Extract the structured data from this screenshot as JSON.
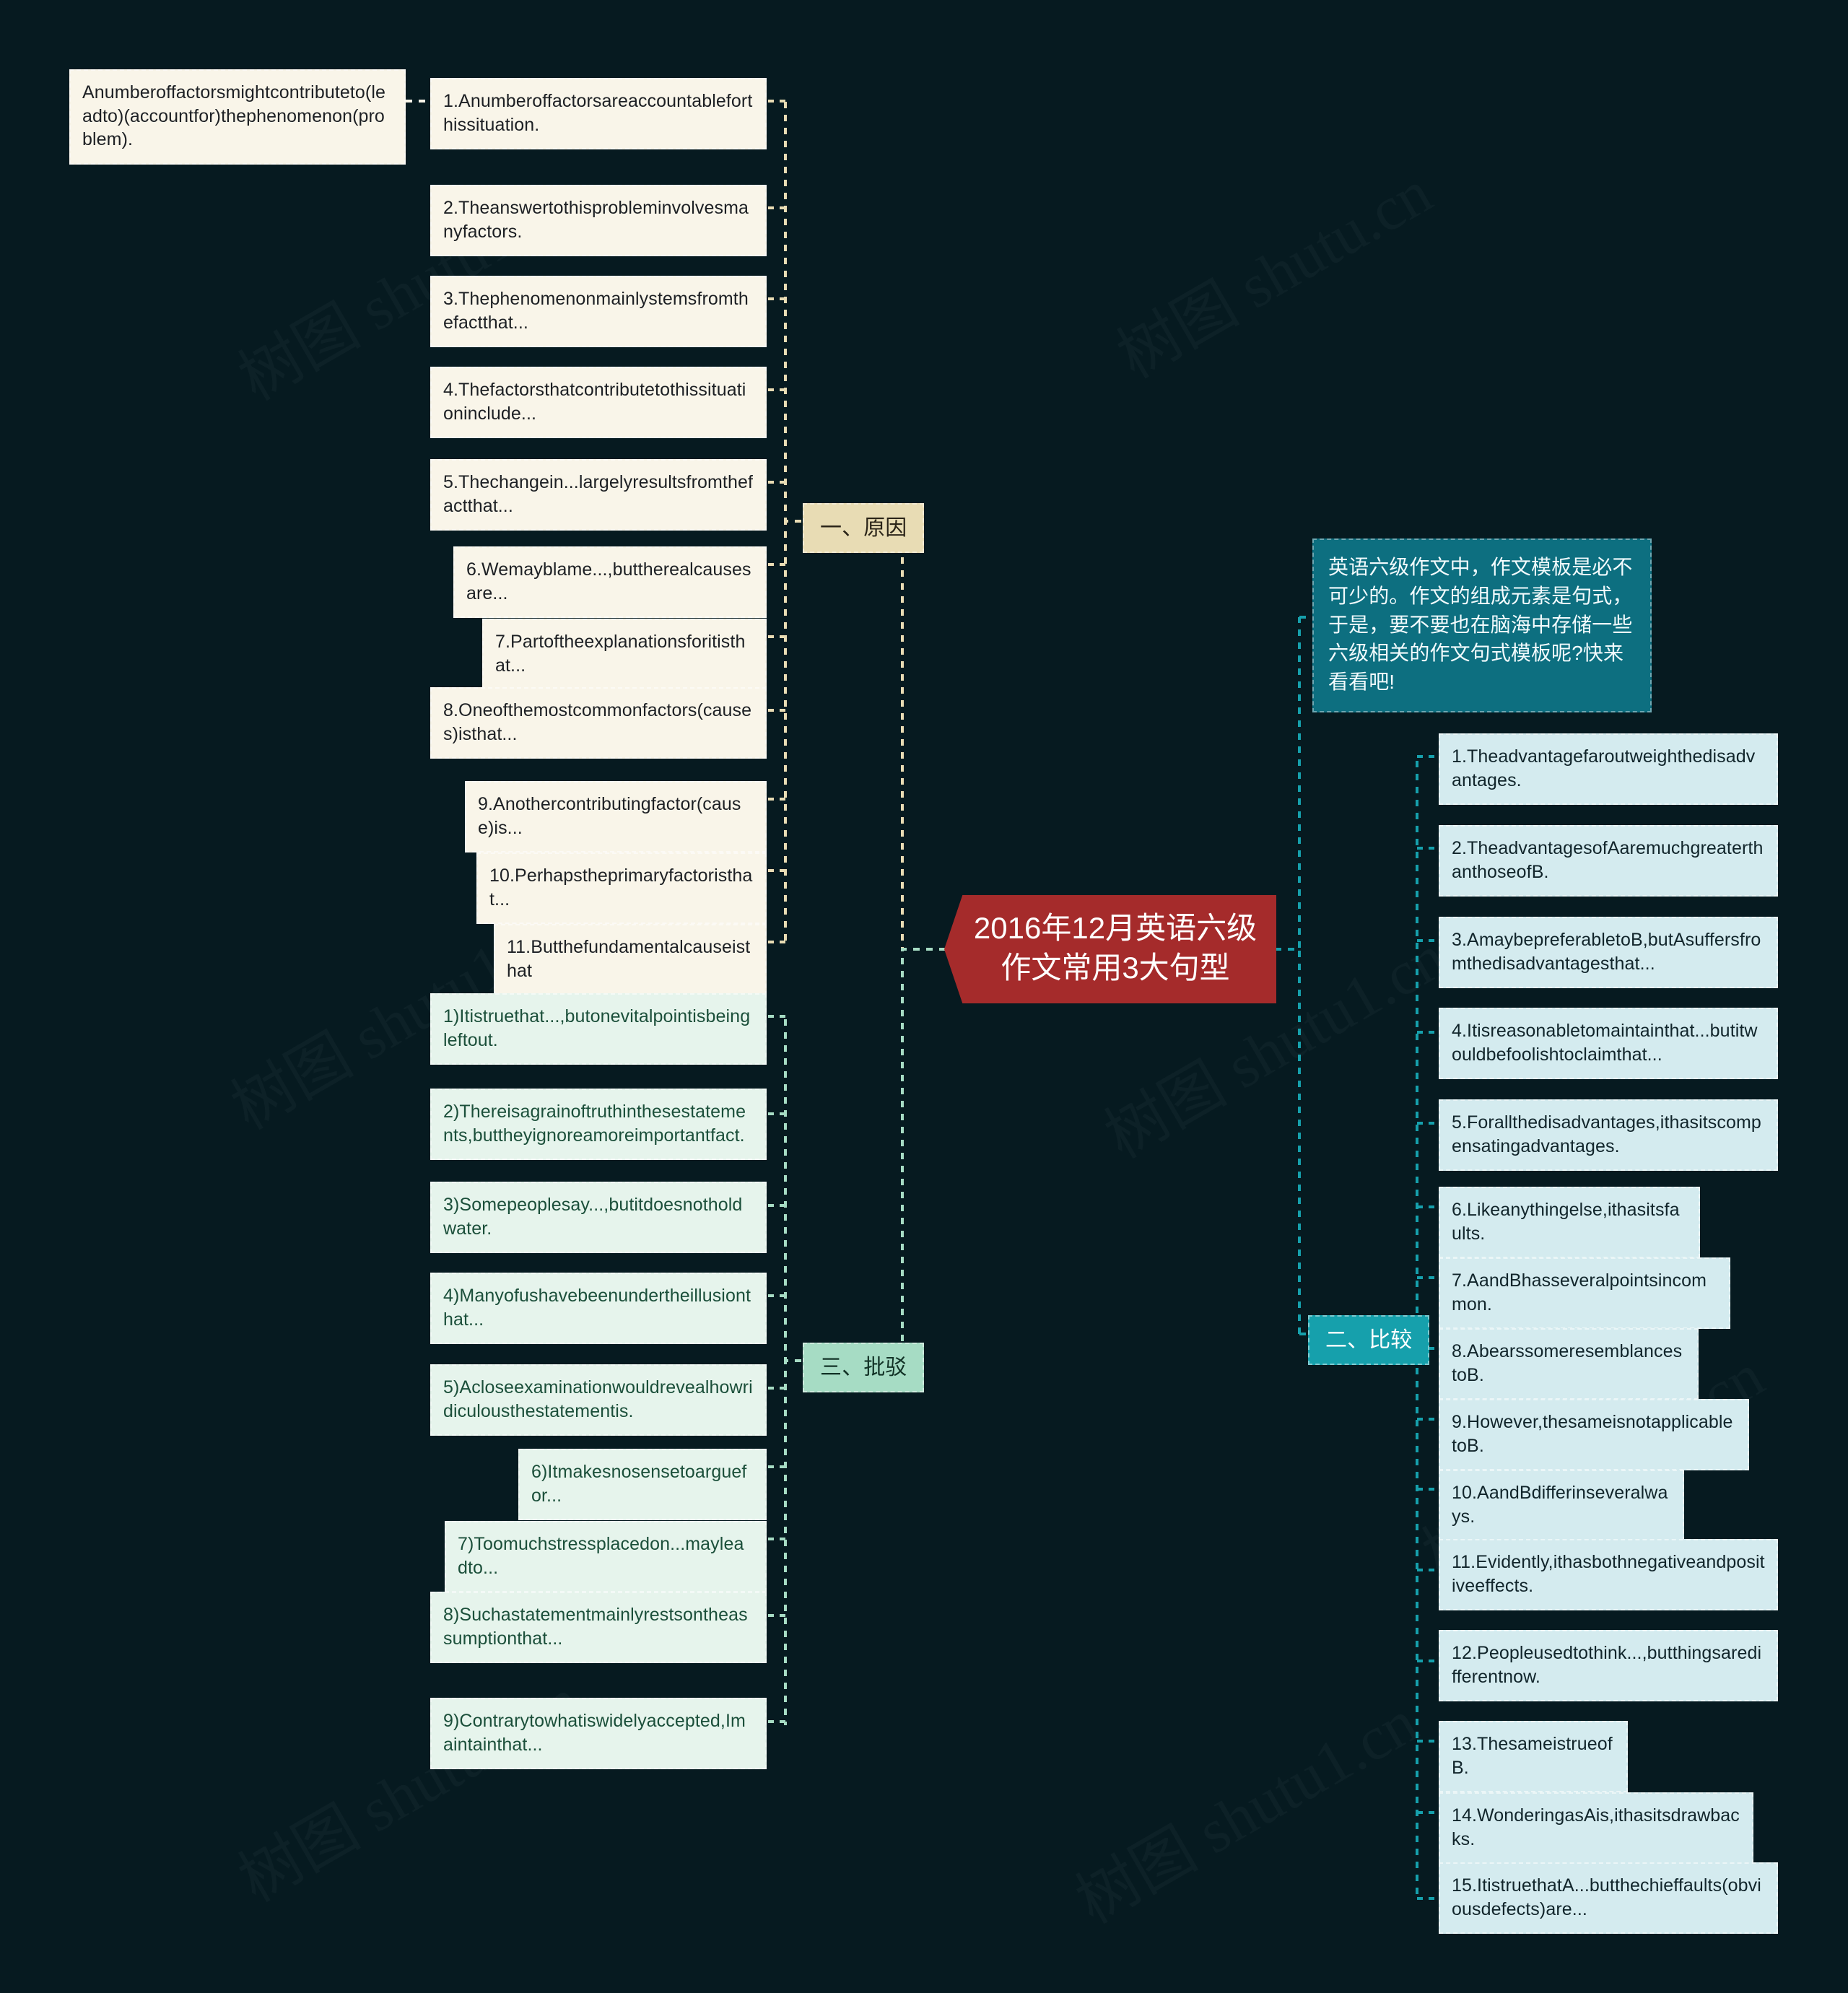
{
  "page": {
    "background_color": "#061a20",
    "watermark_text": "树图 shutu1.cn",
    "watermark_text_alt": "树图 shutu.cn"
  },
  "central": {
    "title": "2016年12月英语六级作文常用3大句型",
    "color": "#a52b2b"
  },
  "description": {
    "text": "英语六级作文中，作文模板是必不可少的。作文的组成元素是句式，于是，要不要也在脑海中存储一些六级相关的作文句式模板呢?快来看看吧!",
    "color": "#0d6f80"
  },
  "root_note": {
    "text": "Anumberoffactorsmightcontributeto(leadto)(accountfor)thephenomenon(problem)."
  },
  "branches": [
    {
      "id": "cause",
      "label": "一、原因",
      "color": "#e8dcb4",
      "items": [
        "1.Anumberoffactorsareaccountableforthissituation.",
        "2.Theanswertothisprobleminvolvesmanyfactors.",
        "3.Thephenomenonmainlystemsfromthefactthat...",
        "4.Thefactorsthatcontributetothissituationinclude...",
        "5.Thechangein...largelyresultsfromthefactthat...",
        "6.Wemayblame...,buttherealcausesare...",
        "7.Partoftheexplanationsforitisthat...",
        "8.Oneofthemostcommonfactors(causes)isthat...",
        "9.Anothercontributingfactor(cause)is...",
        "10.Perhapstheprimaryfactoristhat...",
        "11.Butthefundamentalcauseisthat"
      ]
    },
    {
      "id": "compare",
      "label": "二、比较",
      "color": "#16a0ac",
      "items": [
        "1.Theadvantagefaroutweighthedisadvantages.",
        "2.TheadvantagesofAaremuchgreaterthanthoseofB.",
        "3.AmaybepreferabletoB,butAsuffersfromthedisadvantagesthat...",
        "4.Itisreasonabletomaintainthat...butitwouldbefoolishtoclaimthat...",
        "5.Forallthedisadvantages,ithasitscompensatingadvantages.",
        "6.Likeanythingelse,ithasitsfaults.",
        "7.AandBhasseveralpointsincommon.",
        "8.AbearssomeresemblancestoB.",
        "9.However,thesameisnotapplicabletoB.",
        "10.AandBdifferinseveralways.",
        "11.Evidently,ithasbothnegativeandpositiveeffects.",
        "12.Peopleusedtothink...,butthingsaredifferentnow.",
        "13.ThesameistrueofB.",
        "14.WonderingasAis,ithasitsdrawbacks.",
        "15.ItistruethatA...butthechieffaults(obviousdefects)are..."
      ]
    },
    {
      "id": "refute",
      "label": "三、批驳",
      "color": "#a6dcc4",
      "items": [
        "1)Itistruethat...,butonevitalpointisbeingleftout.",
        "2)Thereisagrainoftruthinthesestatements,buttheyignoreamoreimportantfact.",
        "3)Somepeoplesay...,butitdoesnotholdwater.",
        "4)Manyofushavebeenundertheillusionthat...",
        "5)Acloseexaminationwouldrevealhowridiculousthestatementis.",
        "6)Itmakesnosensetoarguefor...",
        "7)Toomuchstressplacedon...mayleadto...",
        "8)Suchastatementmainlyrestsontheassumptionthat...",
        "9)Contrarytowhatiswidelyaccepted,Imaintainthat..."
      ]
    }
  ]
}
